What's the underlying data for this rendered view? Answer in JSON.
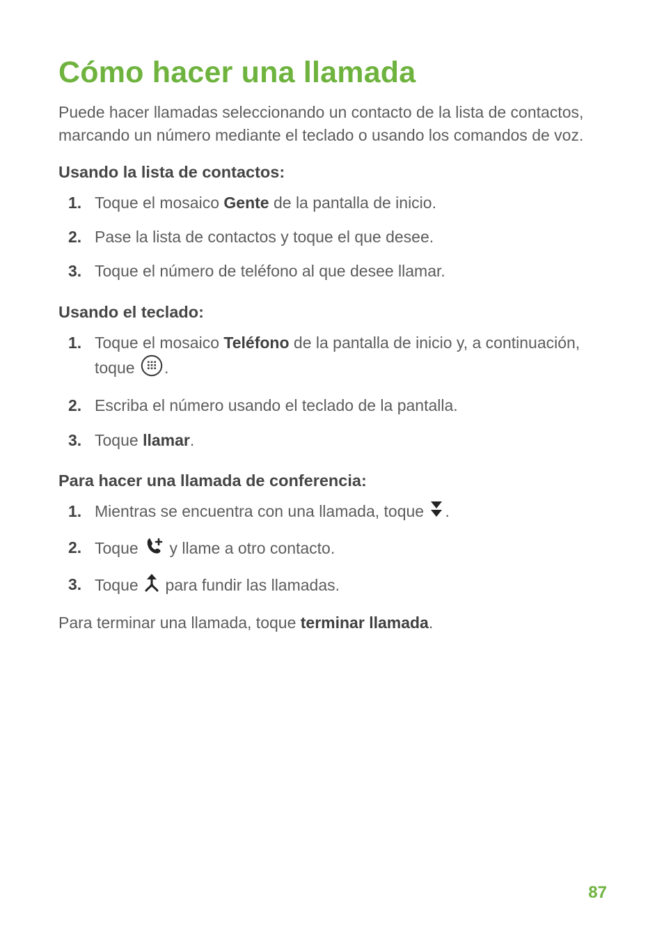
{
  "title": "Cómo hacer una llamada",
  "intro": "Puede hacer llamadas seleccionando un contacto de la lista de contactos, marcando un número mediante el teclado o usando los comandos de voz.",
  "section1": {
    "heading": "Usando la lista de contactos:",
    "steps": {
      "s1": {
        "pre": "Toque el mosaico ",
        "bold": "Gente",
        "post": " de la pantalla de inicio."
      },
      "s2": "Pase la lista de contactos y toque el que desee.",
      "s3": "Toque el número de teléfono al que desee llamar."
    }
  },
  "section2": {
    "heading": "Usando el teclado:",
    "steps": {
      "s1": {
        "pre": "Toque el mosaico ",
        "bold": "Teléfono",
        "post1": " de la pantalla de inicio y, a continuación, toque ",
        "post2": "."
      },
      "s2": "Escriba el número usando el teclado de la pantalla.",
      "s3": {
        "pre": "Toque ",
        "bold": "llamar",
        "post": "."
      }
    }
  },
  "section3": {
    "heading": "Para hacer una llamada de conferencia:",
    "steps": {
      "s1": {
        "pre": "Mientras se encuentra con una llamada, toque ",
        "post": "."
      },
      "s2": {
        "pre": "Toque ",
        "post": " y llame a otro contacto."
      },
      "s3": {
        "pre": "Toque ",
        "post": " para fundir las llamadas."
      }
    }
  },
  "closing": {
    "pre": "Para terminar una llamada, toque ",
    "bold": "terminar llamada",
    "post": "."
  },
  "page_number": "87"
}
